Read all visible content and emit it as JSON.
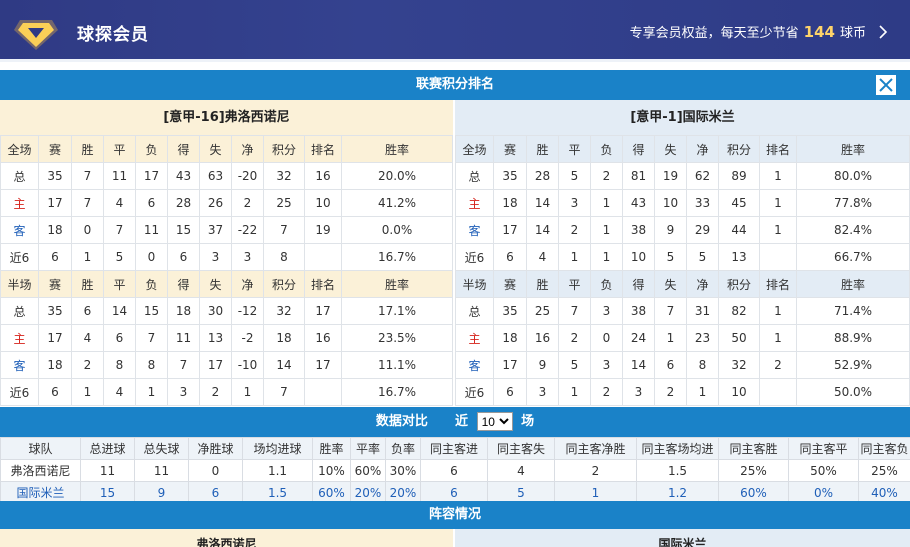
{
  "banner": {
    "title": "球探会员",
    "promo_text": "专享会员权益，每天至少节省",
    "promo_number": "144",
    "promo_unit": "球币",
    "brand_color": "#2f3a84"
  },
  "standings": {
    "title": "联赛积分排名",
    "home_team": "[意甲-16]弗洛西诺尼",
    "away_team": "[意甲-1]国际米兰",
    "columns_full": [
      "全场",
      "赛",
      "胜",
      "平",
      "负",
      "得",
      "失",
      "净",
      "积分",
      "排名",
      "胜率"
    ],
    "columns_half": [
      "半场",
      "赛",
      "胜",
      "平",
      "负",
      "得",
      "失",
      "净",
      "积分",
      "排名",
      "胜率"
    ],
    "home_full": [
      [
        "总",
        "35",
        "7",
        "11",
        "17",
        "43",
        "63",
        "-20",
        "32",
        "16",
        "20.0%"
      ],
      [
        "主",
        "17",
        "7",
        "4",
        "6",
        "28",
        "26",
        "2",
        "25",
        "10",
        "41.2%"
      ],
      [
        "客",
        "18",
        "0",
        "7",
        "11",
        "15",
        "37",
        "-22",
        "7",
        "19",
        "0.0%"
      ],
      [
        "近6",
        "6",
        "1",
        "5",
        "0",
        "6",
        "3",
        "3",
        "8",
        "",
        "16.7%"
      ]
    ],
    "away_full": [
      [
        "总",
        "35",
        "28",
        "5",
        "2",
        "81",
        "19",
        "62",
        "89",
        "1",
        "80.0%"
      ],
      [
        "主",
        "18",
        "14",
        "3",
        "1",
        "43",
        "10",
        "33",
        "45",
        "1",
        "77.8%"
      ],
      [
        "客",
        "17",
        "14",
        "2",
        "1",
        "38",
        "9",
        "29",
        "44",
        "1",
        "82.4%"
      ],
      [
        "近6",
        "6",
        "4",
        "1",
        "1",
        "10",
        "5",
        "5",
        "13",
        "",
        "66.7%"
      ]
    ],
    "home_half": [
      [
        "总",
        "35",
        "6",
        "14",
        "15",
        "18",
        "30",
        "-12",
        "32",
        "17",
        "17.1%"
      ],
      [
        "主",
        "17",
        "4",
        "6",
        "7",
        "11",
        "13",
        "-2",
        "18",
        "16",
        "23.5%"
      ],
      [
        "客",
        "18",
        "2",
        "8",
        "8",
        "7",
        "17",
        "-10",
        "14",
        "17",
        "11.1%"
      ],
      [
        "近6",
        "6",
        "1",
        "4",
        "1",
        "3",
        "2",
        "1",
        "7",
        "",
        "16.7%"
      ]
    ],
    "away_half": [
      [
        "总",
        "35",
        "25",
        "7",
        "3",
        "38",
        "7",
        "31",
        "82",
        "1",
        "71.4%"
      ],
      [
        "主",
        "18",
        "16",
        "2",
        "0",
        "24",
        "1",
        "23",
        "50",
        "1",
        "88.9%"
      ],
      [
        "客",
        "17",
        "9",
        "5",
        "3",
        "14",
        "6",
        "8",
        "32",
        "2",
        "52.9%"
      ],
      [
        "近6",
        "6",
        "3",
        "1",
        "2",
        "3",
        "2",
        "1",
        "10",
        "",
        "50.0%"
      ]
    ]
  },
  "comparison": {
    "title": "数据对比",
    "recent_prefix": "近",
    "recent_value": "10",
    "recent_options": [
      "10"
    ],
    "recent_suffix": "场",
    "headers": [
      "球队",
      "总进球",
      "总失球",
      "净胜球",
      "场均进球",
      "胜率",
      "平率",
      "负率",
      "同主客进",
      "同主客失",
      "同主客净胜",
      "同主客场均进",
      "同主客胜",
      "同主客平",
      "同主客负"
    ],
    "rows": [
      [
        "弗洛西诺尼",
        "11",
        "11",
        "0",
        "1.1",
        "10%",
        "60%",
        "30%",
        "6",
        "4",
        "2",
        "1.5",
        "25%",
        "50%",
        "25%"
      ],
      [
        "国际米兰",
        "15",
        "9",
        "6",
        "1.5",
        "60%",
        "20%",
        "20%",
        "6",
        "5",
        "1",
        "1.2",
        "60%",
        "0%",
        "40%"
      ]
    ]
  },
  "lineup": {
    "title": "阵容情况",
    "home_team": "弗洛西诺尼",
    "away_team": "国际米兰"
  },
  "icons": {
    "logo": "diamond-crown-icon",
    "chevron": "chevron-right-icon",
    "close": "close-icon"
  }
}
